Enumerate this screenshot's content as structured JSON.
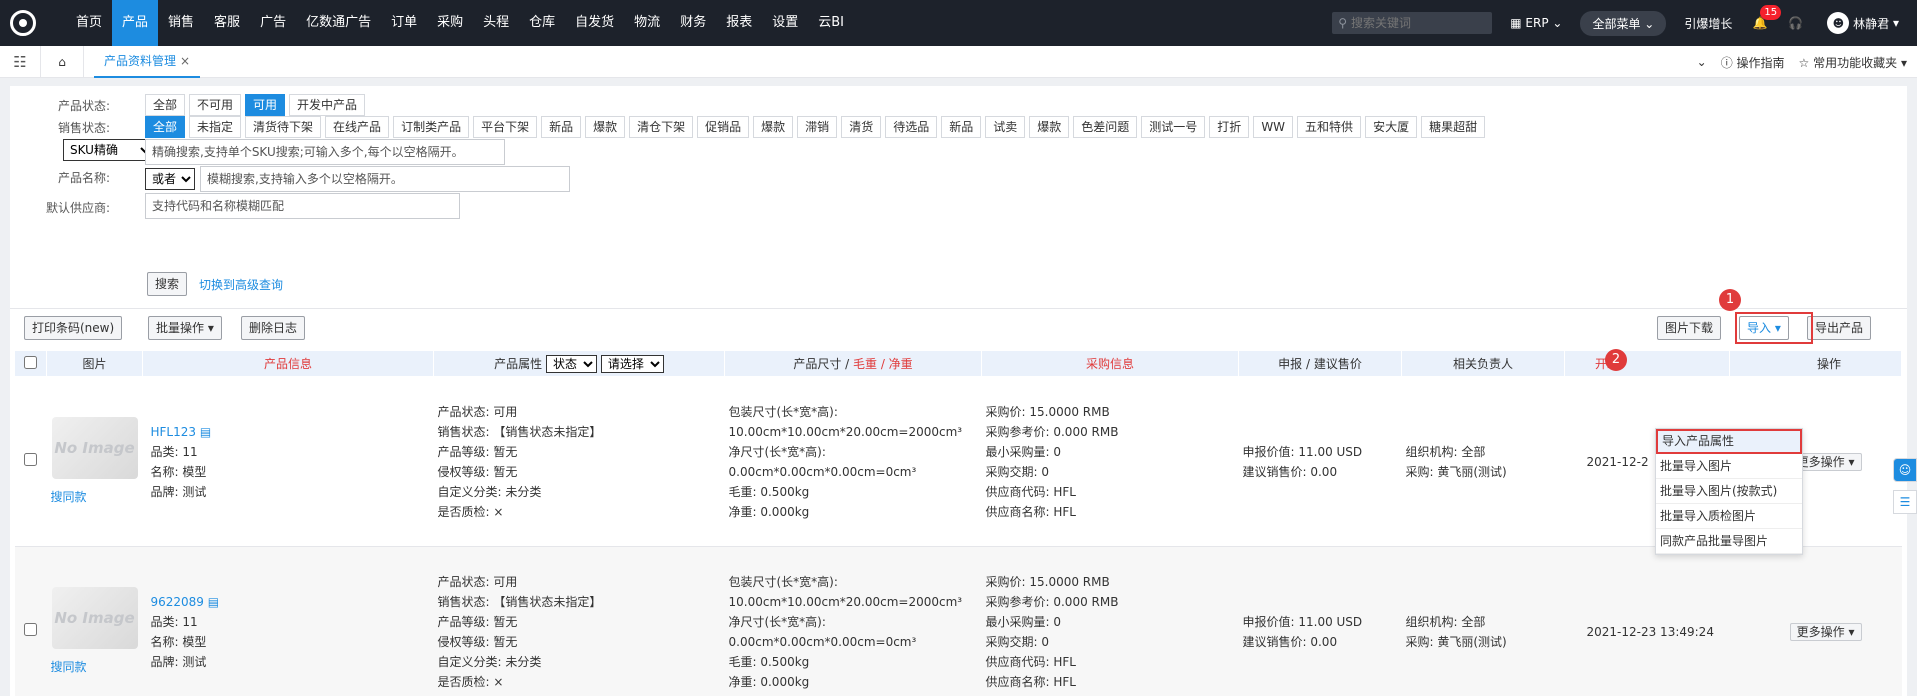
{
  "nav": {
    "items": [
      "首页",
      "产品",
      "销售",
      "客服",
      "广告",
      "亿数通广告",
      "订单",
      "采购",
      "头程",
      "仓库",
      "自发货",
      "物流",
      "财务",
      "报表",
      "设置",
      "云BI"
    ],
    "active_index": 1
  },
  "topbar": {
    "search_placeholder": "搜索关键词",
    "erp_label": "ERP",
    "menu_label": "全部菜单",
    "growth_label": "引爆增长",
    "bell_count": "15",
    "username": "林静君"
  },
  "tabbar": {
    "tab_label": "产品资料管理",
    "guide_label": "操作指南",
    "favorites_label": "常用功能收藏夹"
  },
  "filters": {
    "status_label": "产品状态:",
    "status_chips": [
      "全部",
      "不可用",
      "可用",
      "开发中产品"
    ],
    "status_active": 2,
    "sales_label": "销售状态:",
    "sales_chips": [
      "全部",
      "未指定",
      "清货待下架",
      "在线产品",
      "订制类产品",
      "平台下架",
      "新品",
      "爆款",
      "清仓下架",
      "促销品",
      "爆款",
      "滞销",
      "清货",
      "待选品",
      "新品",
      "试卖",
      "爆款",
      "色差问题",
      "测试一号",
      "打折",
      "WW",
      "五和特供",
      "安大厦",
      "糖果超甜"
    ],
    "sales_active": 0,
    "sku_select": "SKU精确",
    "sku_placeholder": "精确搜索,支持单个SKU搜索;可输入多个,每个以空格隔开。",
    "name_label": "产品名称:",
    "name_select": "或者",
    "name_placeholder": "模糊搜索,支持输入多个以空格隔开。",
    "supplier_label": "默认供应商:",
    "supplier_placeholder": "支持代码和名称模糊匹配",
    "search_button": "搜索",
    "advanced_link": "切换到高级查询"
  },
  "toolbar": {
    "print_barcode": "打印条码(new)",
    "batch_ops": "批量操作",
    "delete_log": "删除日志",
    "image_download": "图片下载",
    "import": "导入",
    "export": "导出产品"
  },
  "table": {
    "headers": {
      "image": "图片",
      "info": "产品信息",
      "attr": "产品属性",
      "attr_sel1": "状态",
      "attr_sel2": "请选择",
      "size_a": "产品尺寸 /",
      "size_b": "毛重 / 净重",
      "purchase": "采购信息",
      "declare": "申报 / 建议售价",
      "owner": "相关负责人",
      "dev": "开发",
      "ops": "操作"
    },
    "rows": [
      {
        "no_image": "No Image",
        "same_style": "搜同款",
        "sku": "HFL123",
        "category": "品类: 11",
        "name": "名称: 模型",
        "brand": "品牌: 测试",
        "attr": [
          "产品状态: 可用",
          "销售状态: 【销售状态未指定】",
          "产品等级: 暂无",
          "侵权等级: 暂无",
          "自定义分类: 未分类",
          "是否质检: ×"
        ],
        "size": [
          "包装尺寸(长*宽*高):",
          "10.00cm*10.00cm*20.00cm=2000cm³",
          "净尺寸(长*宽*高):",
          "0.00cm*0.00cm*0.00cm=0cm³",
          "毛重: 0.500kg",
          "净重: 0.000kg"
        ],
        "purchase": [
          "采购价: 15.0000 RMB",
          "采购参考价: 0.000 RMB",
          "最小采购量: 0",
          "采购交期: 0",
          "供应商代码: HFL",
          "供应商名称: HFL"
        ],
        "declare": [
          "申报价值: 11.00  USD",
          "建议销售价: 0.00"
        ],
        "owner": [
          "组织机构: 全部",
          "采购: 黄飞丽(测试)"
        ],
        "date": "2021-12-2",
        "more": "更多操作"
      },
      {
        "no_image": "No Image",
        "same_style": "搜同款",
        "sku": "9622089",
        "category": "品类: 11",
        "name": "名称: 模型",
        "brand": "品牌: 测试",
        "attr": [
          "产品状态: 可用",
          "销售状态: 【销售状态未指定】",
          "产品等级: 暂无",
          "侵权等级: 暂无",
          "自定义分类: 未分类",
          "是否质检: ×"
        ],
        "size": [
          "包装尺寸(长*宽*高):",
          "10.00cm*10.00cm*20.00cm=2000cm³",
          "净尺寸(长*宽*高):",
          "0.00cm*0.00cm*0.00cm=0cm³",
          "毛重: 0.500kg",
          "净重: 0.000kg"
        ],
        "purchase": [
          "采购价: 15.0000 RMB",
          "采购参考价: 0.000 RMB",
          "最小采购量: 0",
          "采购交期: 0",
          "供应商代码: HFL",
          "供应商名称: HFL"
        ],
        "declare": [
          "申报价值: 11.00  USD",
          "建议销售价: 0.00"
        ],
        "owner": [
          "组织机构: 全部",
          "采购: 黄飞丽(测试)"
        ],
        "date": "2021-12-23 13:49:24",
        "more": "更多操作"
      }
    ]
  },
  "import_menu": [
    "导入产品属性",
    "批量导入图片",
    "批量导入图片(按款式)",
    "批量导入质检图片",
    "同款产品批量导图片"
  ],
  "markers": [
    "1",
    "2"
  ],
  "colors": {
    "accent": "#1d8ce0",
    "topbar": "#1d222b",
    "highlight": "#e03b3b"
  }
}
